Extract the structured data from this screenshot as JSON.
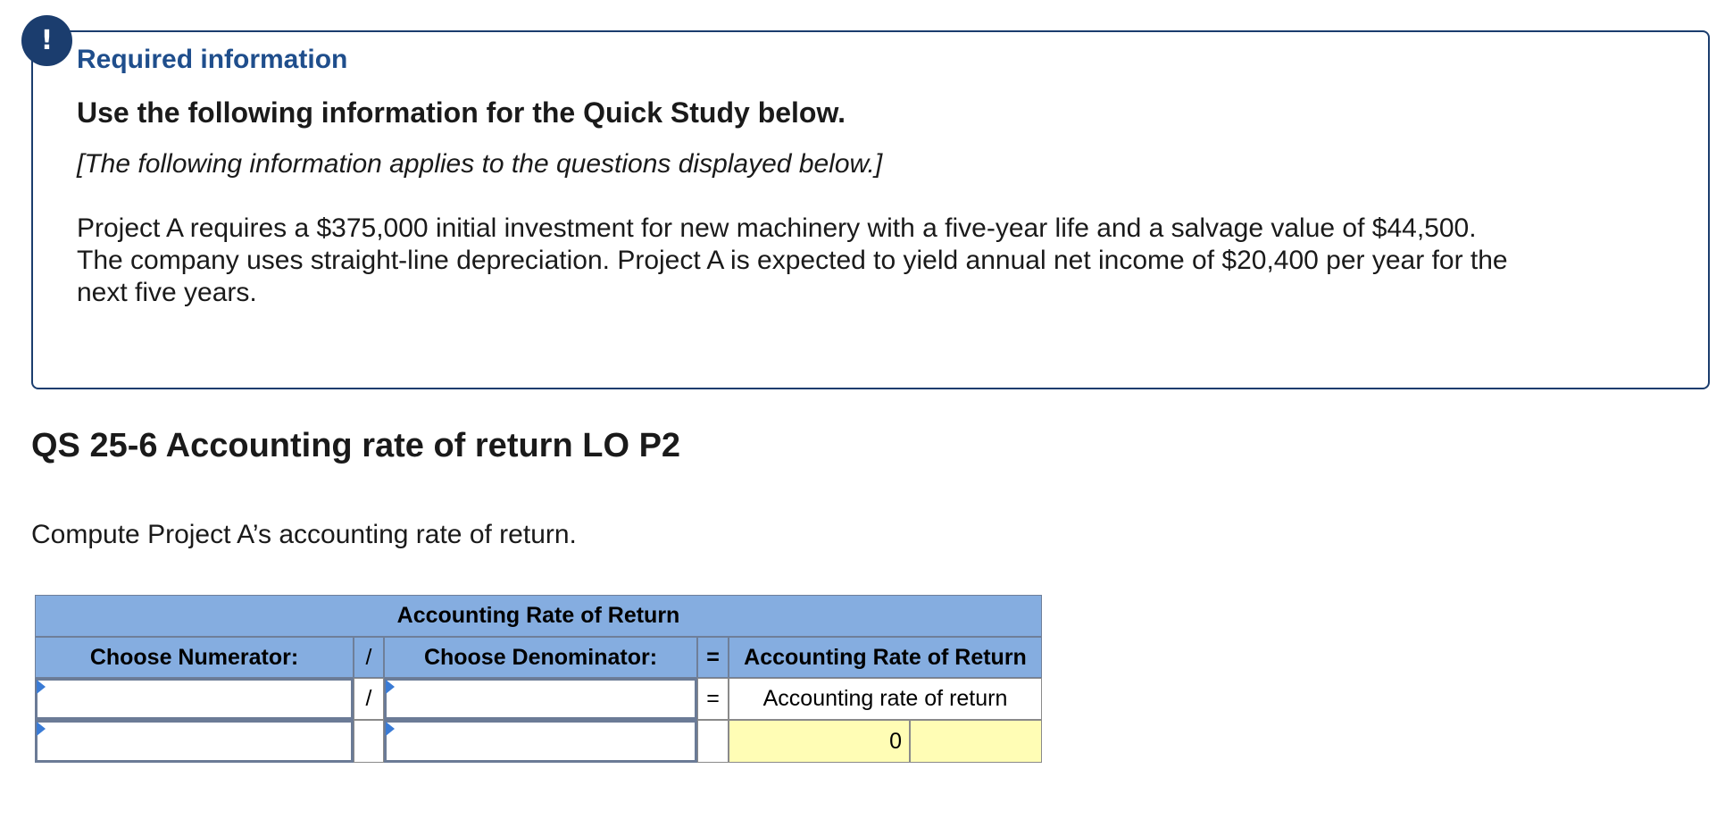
{
  "info_panel": {
    "badge_symbol": "!",
    "badge_icon": "exclamation-icon",
    "required_title": "Required information",
    "use_info": "Use the following information for the Quick Study below.",
    "applies_note": "[The following information applies to the questions displayed below.]",
    "body_line_1": "Project A requires a $375,000 initial investment for new machinery with a five-year life and a salvage value of $44,500.",
    "body_line_2": "The company uses straight-line depreciation. Project A is expected to yield annual net income of $20,400 per year for the",
    "body_line_3": "next five years."
  },
  "question": {
    "title": "QS 25-6 Accounting rate of return LO P2",
    "instruction": "Compute Project A’s accounting rate of return."
  },
  "worksheet": {
    "title": "Accounting Rate of Return",
    "headers": {
      "numerator": "Choose Numerator:",
      "divide": "/",
      "denominator": "Choose Denominator:",
      "equals": "=",
      "result": "Accounting Rate of Return"
    },
    "row1": {
      "numerator_value": "",
      "divide": "/",
      "denominator_value": "",
      "equals": "=",
      "result_label": "Accounting rate of return"
    },
    "row2": {
      "numerator_value": "",
      "denominator_value": "",
      "result_value": "0",
      "result_unit": ""
    }
  },
  "colors": {
    "header_fill": "#85ade0",
    "answer_fill": "#fffdb5",
    "accent_navy": "#1b3d6e",
    "title_blue": "#1f4e8c"
  }
}
